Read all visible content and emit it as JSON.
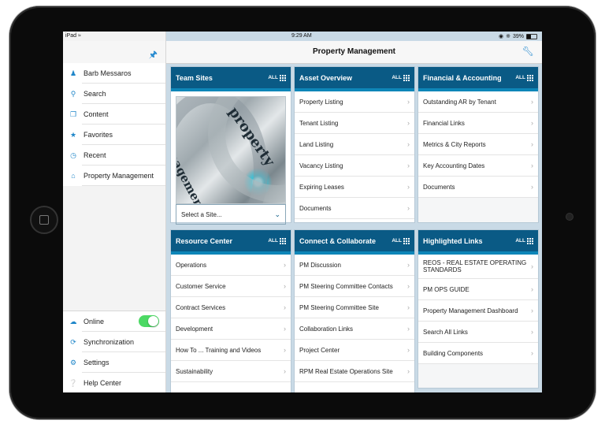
{
  "status_bar": {
    "device": "iPad",
    "time": "9:29 AM",
    "battery": "39%",
    "battery_level": 0.39
  },
  "header": {
    "title": "Property Management"
  },
  "sidebar": {
    "items": [
      {
        "label": "Barb Messaros",
        "icon": "user-icon"
      },
      {
        "label": "Search",
        "icon": "search-icon"
      },
      {
        "label": "Content",
        "icon": "content-icon"
      },
      {
        "label": "Favorites",
        "icon": "star-icon"
      },
      {
        "label": "Recent",
        "icon": "clock-icon"
      },
      {
        "label": "Property Management",
        "icon": "home-icon"
      }
    ],
    "bottom_items": [
      {
        "label": "Online",
        "icon": "cloud-icon",
        "toggle": true
      },
      {
        "label": "Synchronization",
        "icon": "sync-icon"
      },
      {
        "label": "Settings",
        "icon": "gear-icon"
      },
      {
        "label": "Help Center",
        "icon": "help-icon"
      }
    ]
  },
  "all_label": "ALL",
  "panels": {
    "team_sites": {
      "title": "Team Sites",
      "image_text_1": "property",
      "image_text_2": "management",
      "select_placeholder": "Select a Site..."
    },
    "asset_overview": {
      "title": "Asset Overview",
      "items": [
        "Property Listing",
        "Tenant Listing",
        "Land Listing",
        "Vacancy Listing",
        "Expiring Leases",
        "Documents"
      ]
    },
    "financial": {
      "title": "Financial & Accounting",
      "items": [
        "Outstanding AR by Tenant",
        "Financial Links",
        "Metrics & City Reports",
        "Key Accounting Dates",
        "Documents"
      ]
    },
    "resource_center": {
      "title": "Resource Center",
      "items": [
        "Operations",
        "Customer Service",
        "Contract Services",
        "Development",
        "How To ... Training and Videos",
        "Sustainability"
      ]
    },
    "connect": {
      "title": "Connect & Collaborate",
      "items": [
        "PM Discussion",
        "PM Steering Committee Contacts",
        "PM Steering Committee Site",
        "Collaboration Links",
        "Project Center",
        "RPM Real Estate Operations Site"
      ]
    },
    "highlighted": {
      "title": "Highlighted Links",
      "items": [
        "REOS - REAL ESTATE OPERATING STANDARDS",
        "PM OPS GUIDE",
        "Property Management Dashboard",
        "Search All Links",
        "Building Components"
      ]
    }
  },
  "colors": {
    "panel_header": "#0a5a85",
    "accent": "#1f86c9",
    "toggle_on": "#4cd964"
  }
}
